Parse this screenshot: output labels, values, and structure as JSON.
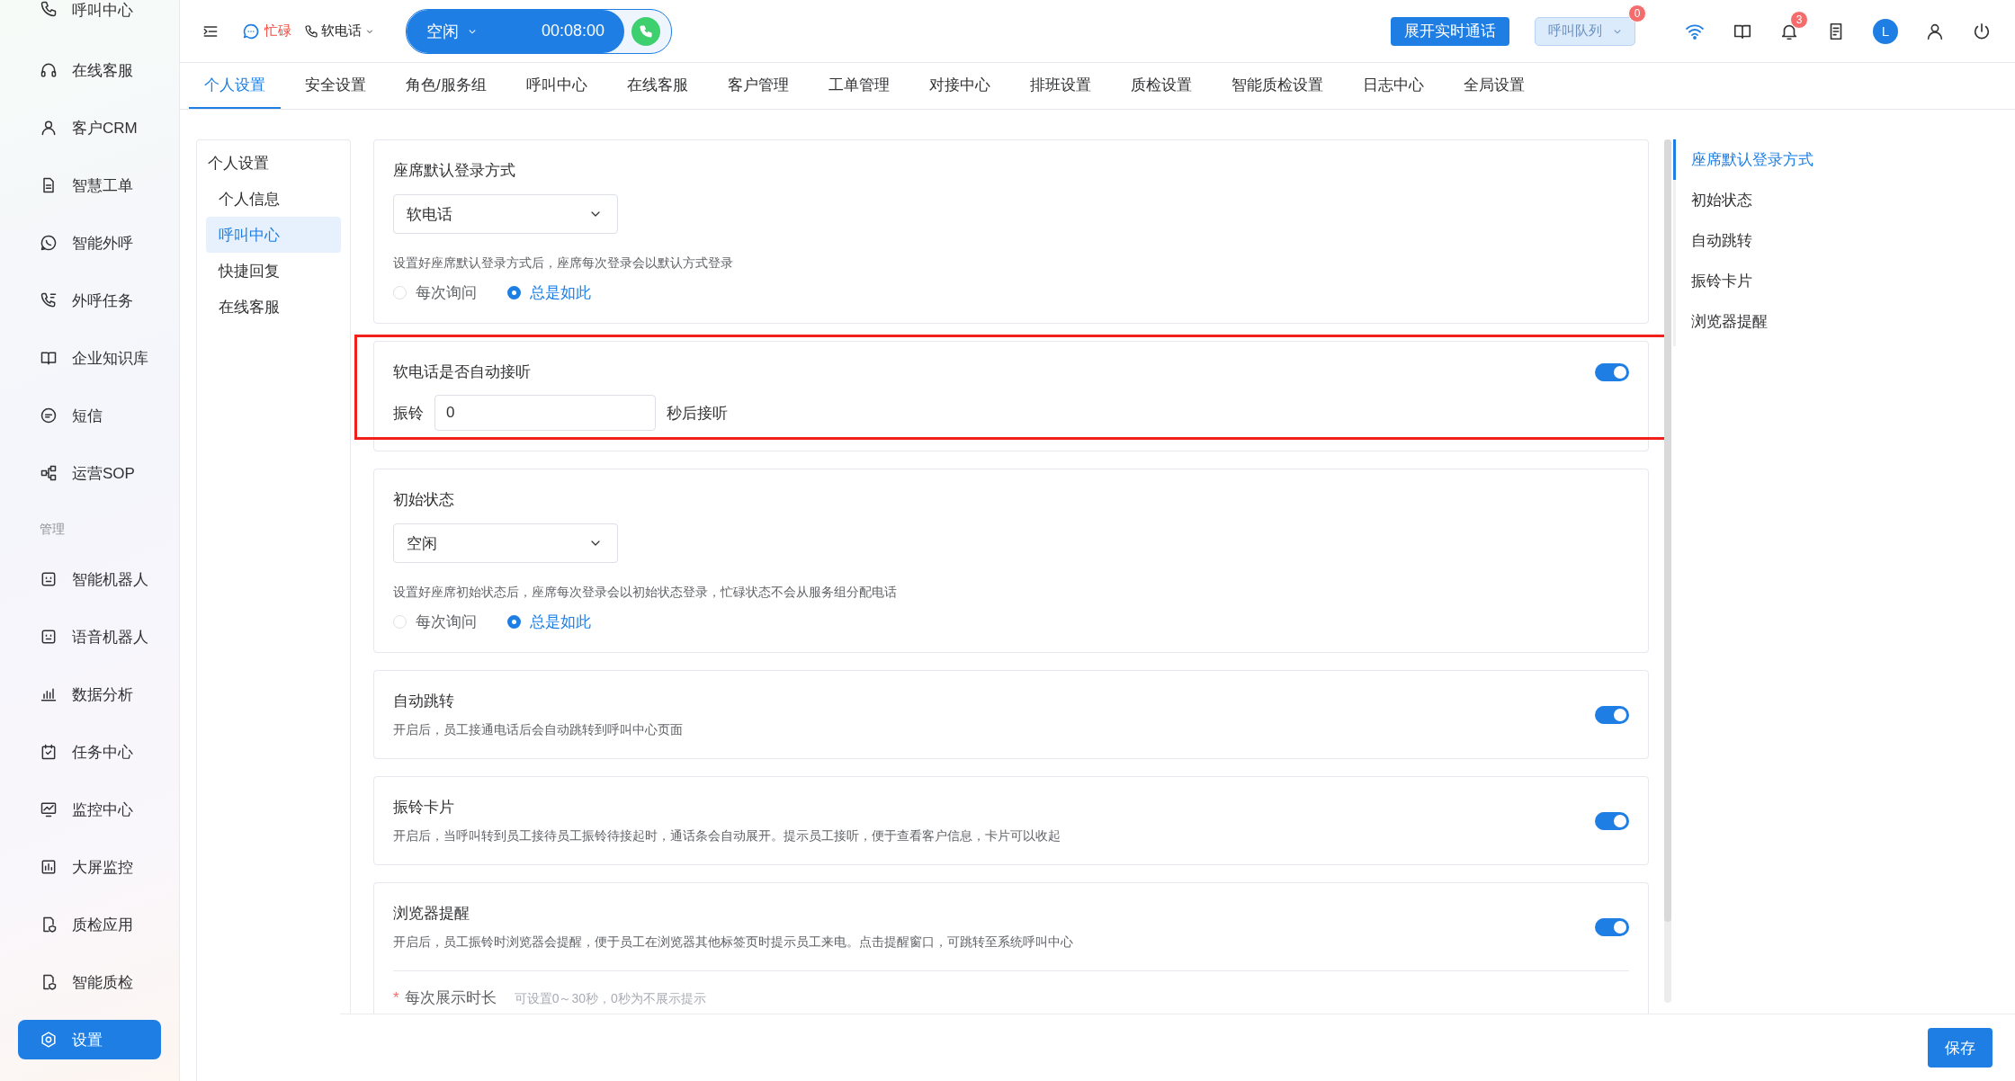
{
  "sidebar": {
    "groups": [
      {
        "items": [
          {
            "label": "呼叫中心",
            "selected": false
          },
          {
            "label": "在线客服",
            "selected": false
          },
          {
            "label": "客户CRM",
            "selected": false
          },
          {
            "label": "智慧工单",
            "selected": false
          },
          {
            "label": "智能外呼",
            "selected": false
          },
          {
            "label": "外呼任务",
            "selected": false
          },
          {
            "label": "企业知识库",
            "selected": false
          },
          {
            "label": "短信",
            "selected": false
          },
          {
            "label": "运营SOP",
            "selected": false
          }
        ]
      },
      {
        "label": "管理",
        "items": [
          {
            "label": "智能机器人",
            "selected": false
          },
          {
            "label": "语音机器人",
            "selected": false
          },
          {
            "label": "数据分析",
            "selected": false
          },
          {
            "label": "任务中心",
            "selected": false
          },
          {
            "label": "监控中心",
            "selected": false
          },
          {
            "label": "大屏监控",
            "selected": false
          },
          {
            "label": "质检应用",
            "selected": false
          },
          {
            "label": "智能质检",
            "selected": false
          },
          {
            "label": "设置",
            "selected": true
          }
        ]
      }
    ]
  },
  "topbar": {
    "status": "忙碌",
    "phone_mode": "软电话",
    "call": {
      "status": "空闲",
      "timer": "00:08:00"
    },
    "realtime_button": "展开实时通话",
    "queue": {
      "label": "呼叫队列",
      "badge": "0"
    },
    "notifications_badge": "3",
    "avatar": "L"
  },
  "tabs": [
    {
      "label": "个人设置",
      "selected": true
    },
    {
      "label": "安全设置",
      "selected": false
    },
    {
      "label": "角色/服务组",
      "selected": false
    },
    {
      "label": "呼叫中心",
      "selected": false
    },
    {
      "label": "在线客服",
      "selected": false
    },
    {
      "label": "客户管理",
      "selected": false
    },
    {
      "label": "工单管理",
      "selected": false
    },
    {
      "label": "对接中心",
      "selected": false
    },
    {
      "label": "排班设置",
      "selected": false
    },
    {
      "label": "质检设置",
      "selected": false
    },
    {
      "label": "智能质检设置",
      "selected": false
    },
    {
      "label": "日志中心",
      "selected": false
    },
    {
      "label": "全局设置",
      "selected": false
    }
  ],
  "submenu": {
    "title": "个人设置",
    "items": [
      {
        "label": "个人信息",
        "selected": false
      },
      {
        "label": "呼叫中心",
        "selected": true
      },
      {
        "label": "快捷回复",
        "selected": false
      },
      {
        "label": "在线客服",
        "selected": false
      }
    ]
  },
  "cards": [
    {
      "kind": "select",
      "title": "座席默认登录方式",
      "value": "软电话",
      "hint": "设置好座席默认登录方式后，座席每次登录会以默认方式登录",
      "options": [
        {
          "label": "每次询问",
          "selected": false
        },
        {
          "label": "总是如此",
          "selected": true
        }
      ]
    },
    {
      "kind": "autoanswer",
      "title": "软电话是否自动接听",
      "on": true,
      "highlighted": true,
      "prefix": "振铃",
      "value": "0",
      "suffix": "秒后接听"
    },
    {
      "kind": "select",
      "title": "初始状态",
      "value": "空闲",
      "hint": "设置好座席初始状态后，座席每次登录会以初始状态登录，忙碌状态不会从服务组分配电话",
      "options": [
        {
          "label": "每次询问",
          "selected": false
        },
        {
          "label": "总是如此",
          "selected": true
        }
      ]
    },
    {
      "kind": "toggle",
      "title": "自动跳转",
      "desc": "开启后，员工接通电话后会自动跳转到呼叫中心页面",
      "on": true
    },
    {
      "kind": "toggle",
      "title": "振铃卡片",
      "desc": "开启后，当呼叫转到员工接待员工振铃待接起时，通话条会自动展开。提示员工接听，便于查看客户信息，卡片可以收起",
      "on": true
    },
    {
      "kind": "toggle",
      "title": "浏览器提醒",
      "desc": "开启后，员工振铃时浏览器会提醒，便于员工在浏览器其他标签页时提示员工来电。点击提醒窗口，可跳转至系统呼叫中心",
      "on": true,
      "field": {
        "required_mark": "*",
        "label": "每次展示时长",
        "hint": "可设置0～30秒，0秒为不展示提示"
      }
    }
  ],
  "anchors": [
    {
      "label": "座席默认登录方式",
      "selected": true
    },
    {
      "label": "初始状态",
      "selected": false
    },
    {
      "label": "自动跳转",
      "selected": false
    },
    {
      "label": "振铃卡片",
      "selected": false
    },
    {
      "label": "浏览器提醒",
      "selected": false
    }
  ],
  "footer": {
    "save_button": "保存"
  }
}
